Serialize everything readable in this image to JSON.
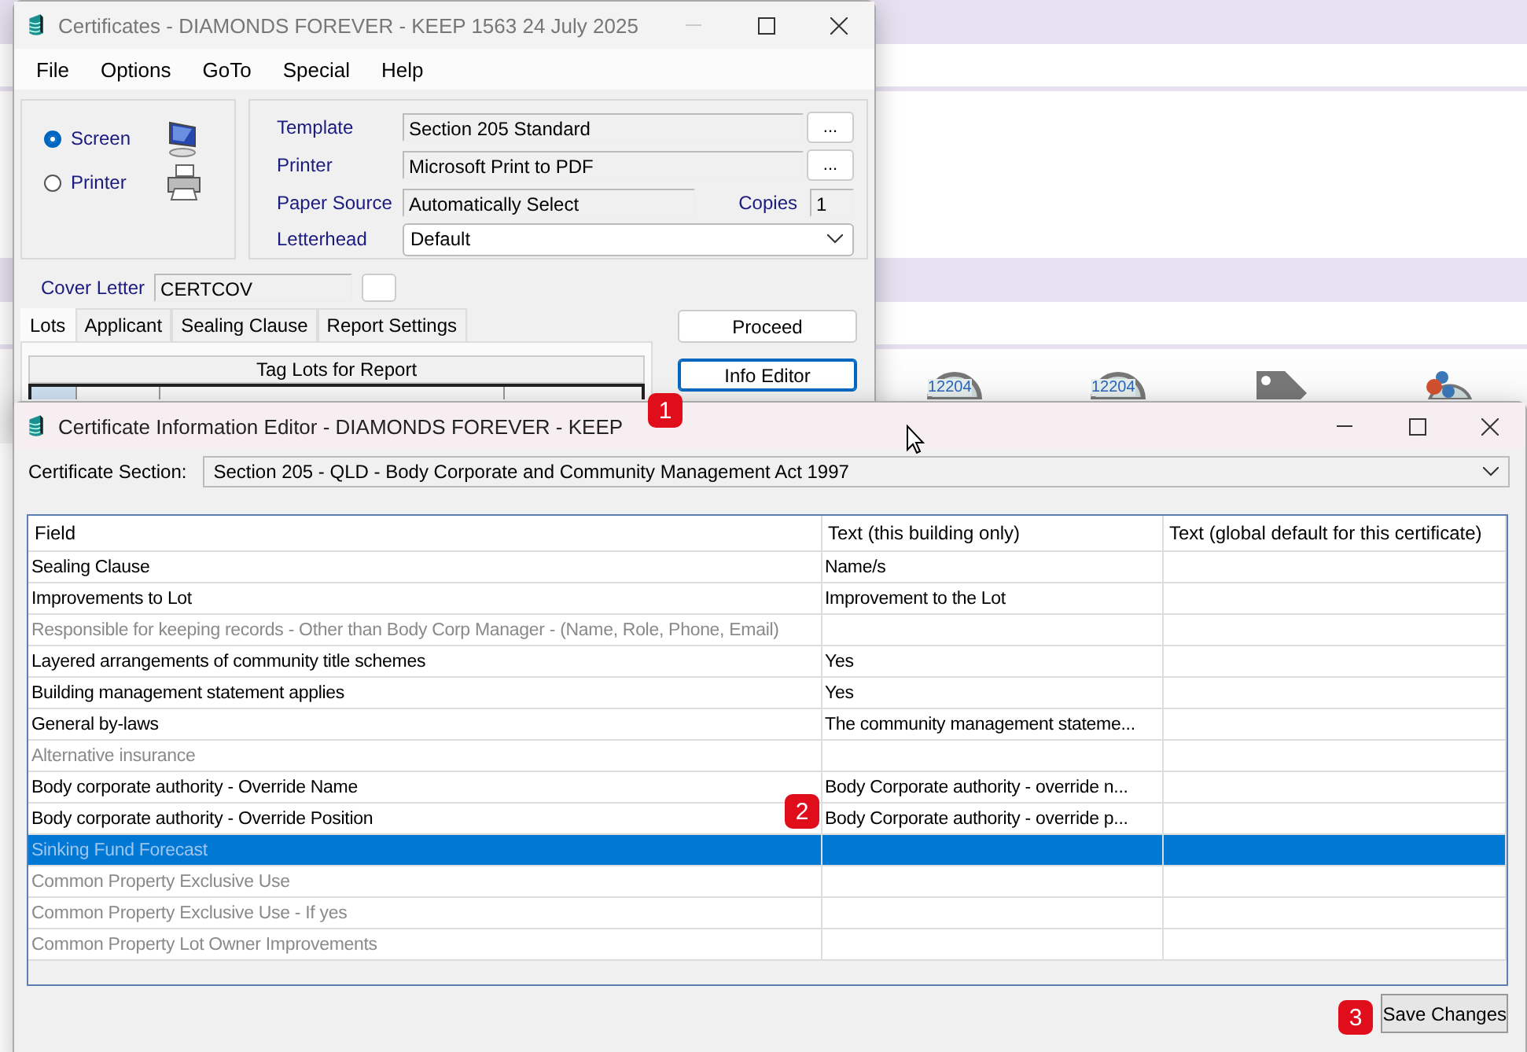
{
  "background_app": {
    "toolbar": [
      {
        "kind": "clock",
        "label": "12204"
      },
      {
        "kind": "clock",
        "label": "12204"
      },
      {
        "kind": "tag"
      },
      {
        "kind": "people"
      }
    ]
  },
  "main_window": {
    "title": "Certificates - DIAMONDS FOREVER - KEEP 1563 24 July 2025",
    "menu": [
      "File",
      "Options",
      "GoTo",
      "Special",
      "Help"
    ],
    "output": [
      {
        "label": "Screen",
        "selected": true,
        "kind": "monitor"
      },
      {
        "label": "Printer",
        "selected": false,
        "kind": "printer"
      }
    ],
    "template": {
      "label": "Template",
      "value": "Section 205 Standard",
      "button": "..."
    },
    "printer": {
      "label": "Printer",
      "value": "Microsoft Print to PDF",
      "button": "..."
    },
    "paper_source": {
      "label": "Paper Source",
      "value": "Automatically Select"
    },
    "copies": {
      "label": "Copies",
      "value": "1"
    },
    "letterhead": {
      "label": "Letterhead",
      "value": "Default"
    },
    "cover_letter": {
      "label": "Cover Letter",
      "value": "CERTCOV"
    },
    "tabs": [
      {
        "label": "Lots",
        "selected": true
      },
      {
        "label": "Applicant",
        "selected": false
      },
      {
        "label": "Sealing Clause",
        "selected": false
      },
      {
        "label": "Report Settings",
        "selected": false
      }
    ],
    "lots_table_title": "Tag Lots for Report",
    "buttons": [
      {
        "label": "Proceed",
        "focused": false
      },
      {
        "label": "Info Editor",
        "focused": true
      }
    ]
  },
  "editor_window": {
    "title": "Certificate Information Editor - DIAMONDS FOREVER - KEEP",
    "section": {
      "label": "Certificate Section:",
      "value": "Section 205 - QLD - Body Corporate and Community Management Act 1997"
    },
    "table": {
      "columns": [
        "Field",
        "Text (this building only)",
        "Text (global default for this certificate)"
      ],
      "rows": [
        {
          "field": "Sealing Clause",
          "text": "Name/s",
          "disabled": false,
          "selected": false
        },
        {
          "field": "Improvements to Lot",
          "text": "Improvement to the Lot",
          "disabled": false,
          "selected": false
        },
        {
          "field": "Responsible for keeping records - Other than Body Corp Manager - (Name, Role, Phone, Email)",
          "text": "",
          "disabled": true,
          "selected": false
        },
        {
          "field": "Layered arrangements of community title schemes",
          "text": "Yes",
          "disabled": false,
          "selected": false
        },
        {
          "field": "Building management statement applies",
          "text": "Yes",
          "disabled": false,
          "selected": false
        },
        {
          "field": "General by-laws",
          "text": "The community management stateme...",
          "disabled": false,
          "selected": false
        },
        {
          "field": "Alternative insurance",
          "text": "",
          "disabled": true,
          "selected": false
        },
        {
          "field": "Body corporate authority - Override Name",
          "text": "Body Corporate authority - override n...",
          "disabled": false,
          "selected": false
        },
        {
          "field": "Body corporate authority - Override Position",
          "text": "Body Corporate authority - override p...",
          "disabled": false,
          "selected": false
        },
        {
          "field": "Sinking Fund Forecast",
          "text": "",
          "disabled": true,
          "selected": true
        },
        {
          "field": "Common Property Exclusive Use",
          "text": "",
          "disabled": true,
          "selected": false
        },
        {
          "field": "Common Property Exclusive Use - If yes",
          "text": "",
          "disabled": true,
          "selected": false
        },
        {
          "field": "Common Property Lot Owner Improvements",
          "text": "",
          "disabled": true,
          "selected": false
        }
      ]
    },
    "save_button": "Save Changes"
  },
  "callouts": [
    "1",
    "2",
    "3"
  ]
}
